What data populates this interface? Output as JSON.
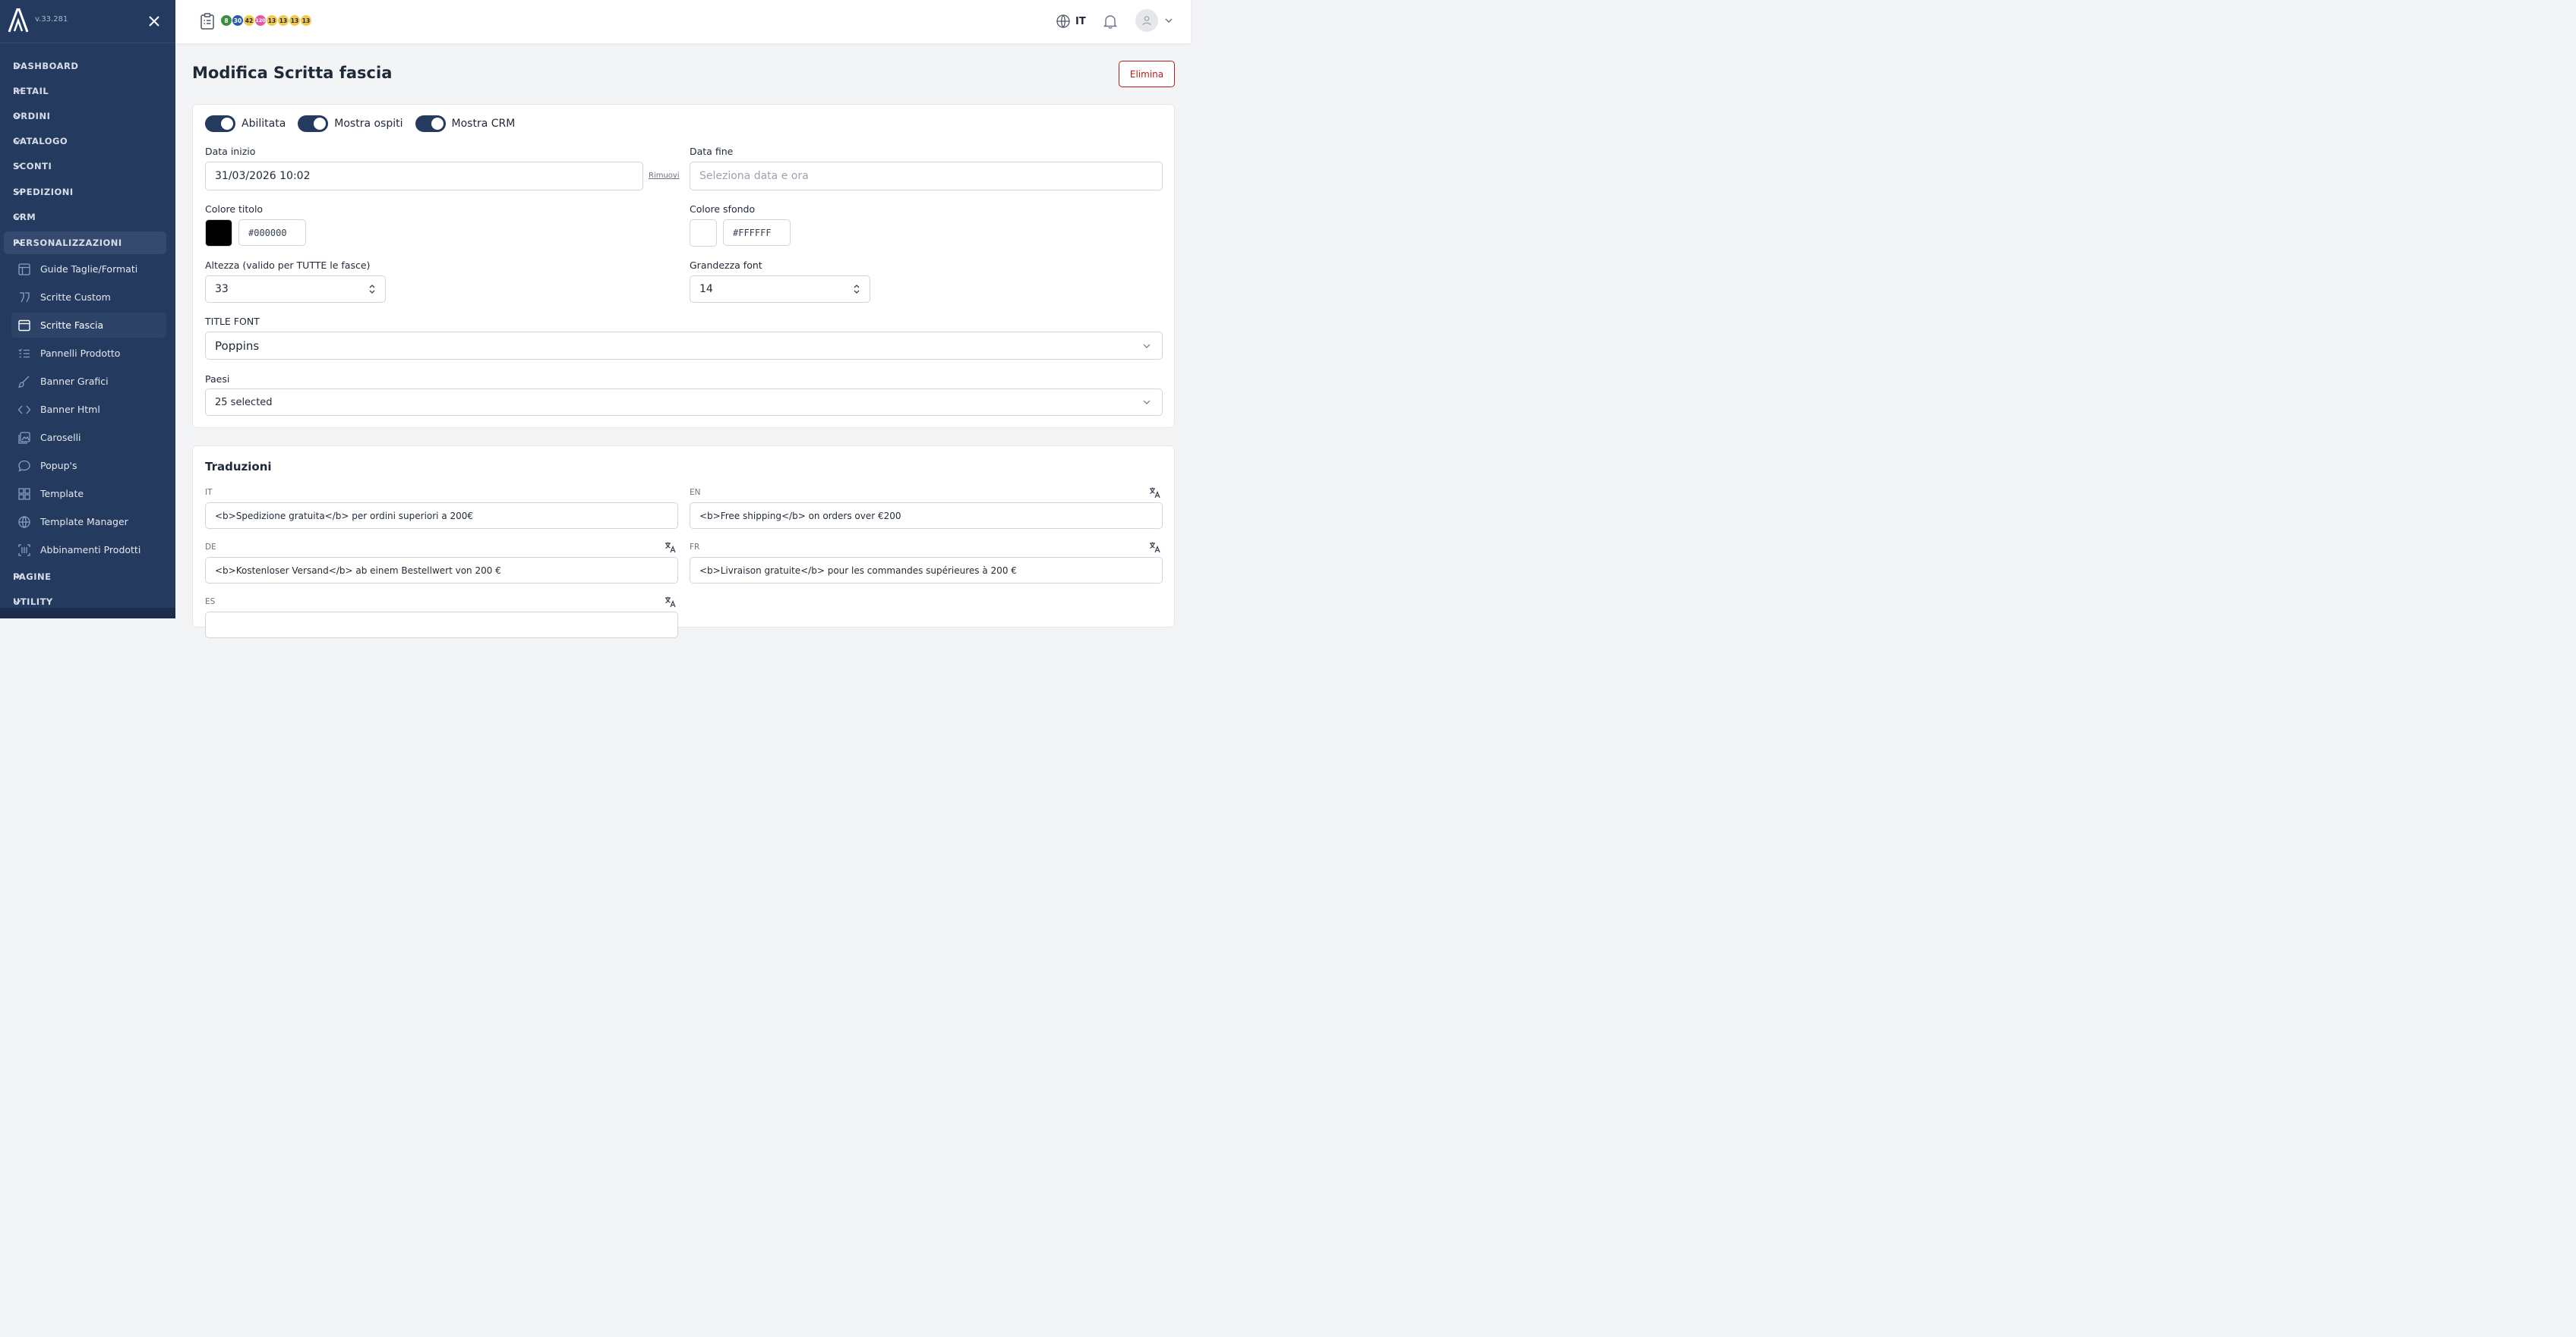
{
  "app": {
    "version": "v.33.281"
  },
  "sidebar": {
    "sections": [
      {
        "label": "DASHBOARD"
      },
      {
        "label": "RETAIL"
      },
      {
        "label": "ORDINI"
      },
      {
        "label": "CATALOGO"
      },
      {
        "label": "SCONTI"
      },
      {
        "label": "SPEDIZIONI"
      },
      {
        "label": "CRM"
      },
      {
        "label": "PERSONALIZZAZIONI"
      },
      {
        "label": "PAGINE"
      },
      {
        "label": "UTILITY"
      }
    ],
    "sub_items": [
      {
        "label": "Guide Taglie/Formati",
        "icon": "table-icon"
      },
      {
        "label": "Scritte Custom",
        "icon": "quote-icon"
      },
      {
        "label": "Scritte Fascia",
        "icon": "window-icon"
      },
      {
        "label": "Pannelli Prodotto",
        "icon": "list-icon"
      },
      {
        "label": "Banner Grafici",
        "icon": "brush-icon"
      },
      {
        "label": "Banner Html",
        "icon": "code-icon"
      },
      {
        "label": "Caroselli",
        "icon": "images-icon"
      },
      {
        "label": "Popup's",
        "icon": "chat-bubble-icon"
      },
      {
        "label": "Template",
        "icon": "grid-icon"
      },
      {
        "label": "Template Manager",
        "icon": "globe-icon"
      },
      {
        "label": "Abbinamenti Prodotti",
        "icon": "barcode-icon"
      }
    ]
  },
  "topbar": {
    "badges": [
      {
        "value": "8",
        "color": "#3e8e41",
        "text_color": "#ffffff"
      },
      {
        "value": "30",
        "color": "#2a5db0",
        "text_color": "#ffffff"
      },
      {
        "value": "42",
        "color": "#f2c94c",
        "text_color": "#1f2937"
      },
      {
        "value": "120",
        "color": "#e05aa9",
        "text_color": "#ffffff"
      },
      {
        "value": "13",
        "color": "#f2c94c",
        "text_color": "#1f2937"
      },
      {
        "value": "13",
        "color": "#f2c94c",
        "text_color": "#1f2937"
      },
      {
        "value": "13",
        "color": "#f2c94c",
        "text_color": "#1f2937"
      },
      {
        "value": "13",
        "color": "#f2c94c",
        "text_color": "#1f2937"
      }
    ],
    "language": "IT"
  },
  "page": {
    "title": "Modifica Scritta fascia",
    "delete_label": "Elimina"
  },
  "form": {
    "toggles": [
      {
        "label": "Abilitata",
        "on": true
      },
      {
        "label": "Mostra ospiti",
        "on": true
      },
      {
        "label": "Mostra CRM",
        "on": true
      }
    ],
    "start_date": {
      "label": "Data inizio",
      "value": "31/03/2026 10:02",
      "remove_label": "Rimuovi"
    },
    "end_date": {
      "label": "Data fine",
      "placeholder": "Seleziona data e ora"
    },
    "title_color": {
      "label": "Colore titolo",
      "value": "#000000"
    },
    "bg_color": {
      "label": "Colore sfondo",
      "value": "#FFFFFF"
    },
    "height": {
      "label": "Altezza (valido per TUTTE le fasce)",
      "value": "33"
    },
    "font_size": {
      "label": "Grandezza font",
      "value": "14"
    },
    "title_font": {
      "label": "TITLE FONT",
      "value": "Poppins"
    },
    "countries": {
      "label": "Paesi",
      "value": "25 selected"
    }
  },
  "translations": {
    "title": "Traduzioni",
    "it": {
      "label": "IT",
      "value": "<b>Spedizione gratuita</b> per ordini superiori a 200€"
    },
    "en": {
      "label": "EN",
      "value": "<b>Free shipping</b> on orders over €200"
    },
    "de": {
      "label": "DE",
      "value": "<b>Kostenloser Versand</b> ab einem Bestellwert von 200 €"
    },
    "fr": {
      "label": "FR",
      "value": "<b>Livraison gratuite</b> pour les commandes supérieures à 200 €"
    },
    "es": {
      "label": "ES"
    }
  },
  "colors": {
    "sidebar_bg": "#243a5e",
    "accent": "#243a5e",
    "danger": "#b91c1c"
  }
}
